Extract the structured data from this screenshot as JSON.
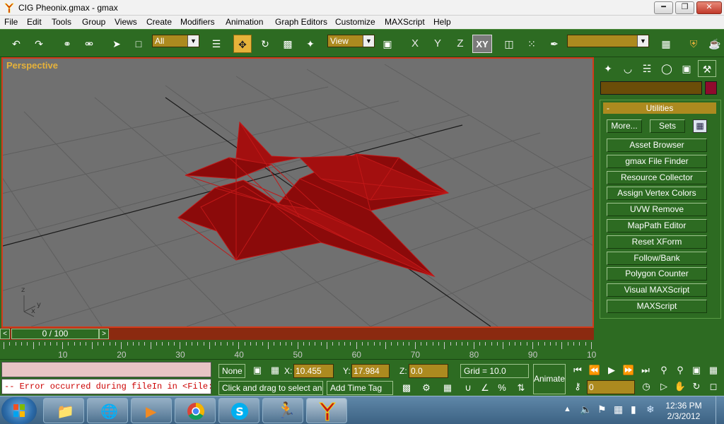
{
  "window": {
    "title": "CIG Pheonix.gmax - gmax"
  },
  "menu": [
    "File",
    "Edit",
    "Tools",
    "Group",
    "Views",
    "Create",
    "Modifiers",
    "Animation",
    "Graph Editors",
    "Customize",
    "MAXScript",
    "Help"
  ],
  "toolbar": {
    "selection_filter": "All",
    "reference_coord": "View",
    "axis_x": "X",
    "axis_y": "Y",
    "axis_z": "Z",
    "axis_xy": "XY",
    "named_selection": ""
  },
  "viewport": {
    "label": "Perspective",
    "gizmo_z": "z",
    "gizmo_y": "y",
    "gizmo_x": "x",
    "object_color": "#8b0a0a",
    "wire_color": "#c11818",
    "grid_color": "#5e5e5e",
    "border_color": "#d33a1a"
  },
  "command_panel": {
    "rollout_title": "Utilities",
    "rollout_toggle": "-",
    "more_button": "More...",
    "sets_button": "Sets",
    "utilities": [
      "Asset Browser",
      "gmax File Finder",
      "Resource Collector",
      "Assign Vertex Colors",
      "UVW Remove",
      "MapPath Editor",
      "Reset XForm",
      "Follow/Bank",
      "Polygon Counter",
      "Visual MAXScript",
      "MAXScript"
    ],
    "object_color": "#900a2d"
  },
  "timeline": {
    "slider_label": "0 / 100",
    "prev_arrow": "<",
    "next_arrow": ">",
    "ruler_labels": [
      "10",
      "20",
      "30",
      "40",
      "50",
      "60",
      "70",
      "80",
      "90",
      "10"
    ]
  },
  "status": {
    "listener_error": "-- Error occurred during fileIn in <File:C",
    "selection_info": "None S",
    "prompt": "Click and drag to select and m",
    "x_label": "X:",
    "x_value": "10.455",
    "y_label": "Y:",
    "y_value": "17.984",
    "z_label": "Z:",
    "z_value": "0.0",
    "grid": "Grid = 10.0",
    "time_tag": "Add Time Tag",
    "animate": "Animate",
    "frame": "0"
  },
  "taskbar": {
    "time": "12:36 PM",
    "date": "2/3/2012"
  },
  "colors": {
    "panel_green": "#2d6b22",
    "field_gold": "#ac8a1f",
    "active_yellow": "#e6b23a"
  }
}
